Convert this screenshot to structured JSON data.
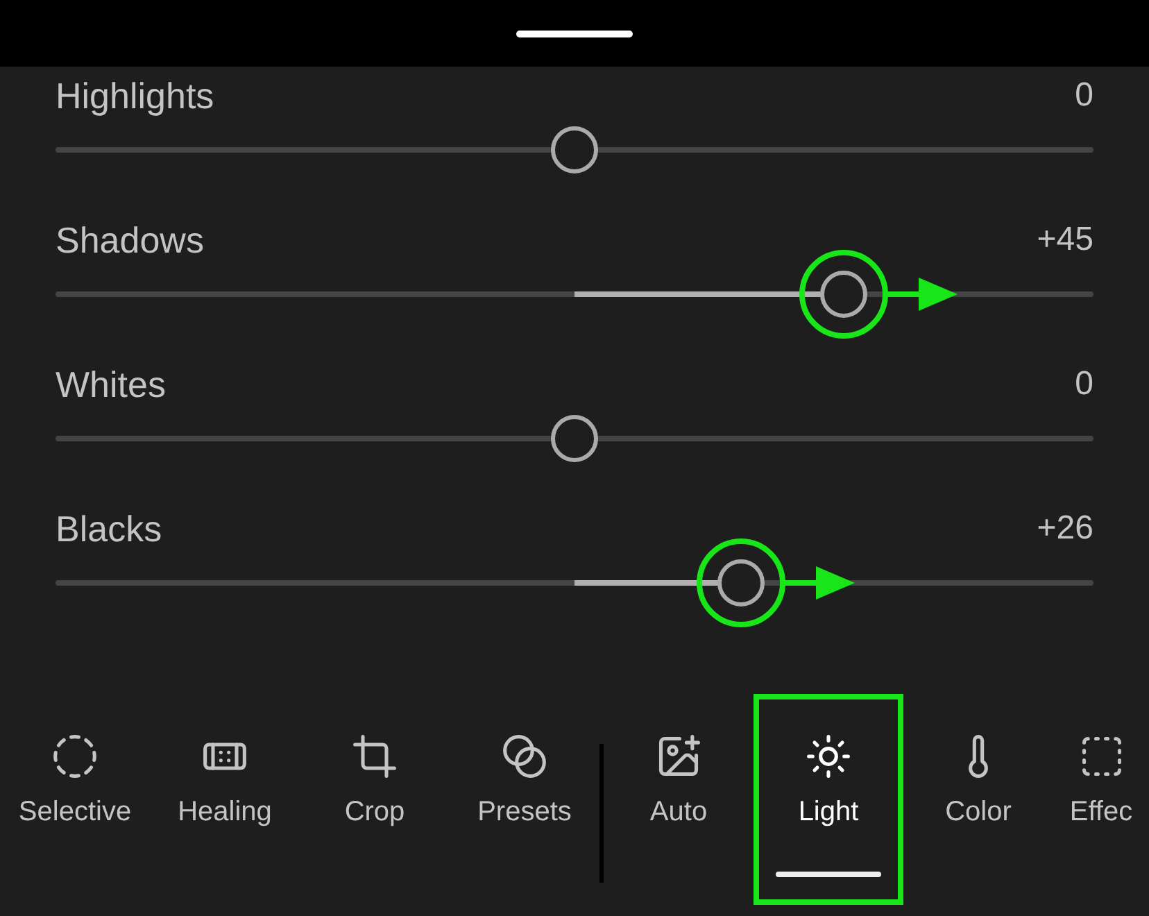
{
  "sliders": [
    {
      "label": "Highlights",
      "value": "0",
      "level": 0.5,
      "annotated": false
    },
    {
      "label": "Shadows",
      "value": "+45",
      "level": 0.76,
      "annotated": true
    },
    {
      "label": "Whites",
      "value": "0",
      "level": 0.5,
      "annotated": false
    },
    {
      "label": "Blacks",
      "value": "+26",
      "level": 0.66,
      "annotated": true
    }
  ],
  "tools": [
    {
      "label": "Selective",
      "selected": false,
      "annotated": false
    },
    {
      "label": "Healing",
      "selected": false,
      "annotated": false
    },
    {
      "label": "Crop",
      "selected": false,
      "annotated": false
    },
    {
      "label": "Presets",
      "selected": false,
      "annotated": false
    },
    {
      "label": "Auto",
      "selected": false,
      "annotated": false
    },
    {
      "label": "Light",
      "selected": true,
      "annotated": true
    },
    {
      "label": "Color",
      "selected": false,
      "annotated": false
    },
    {
      "label": "Effec",
      "selected": false,
      "annotated": false
    }
  ]
}
